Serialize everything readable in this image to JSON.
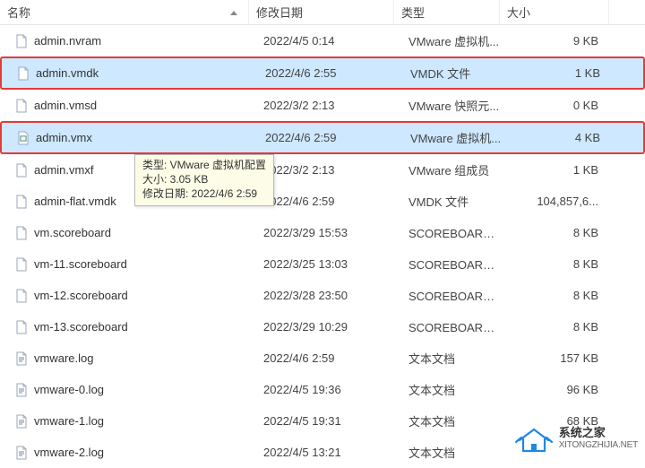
{
  "columns": {
    "name": "名称",
    "date": "修改日期",
    "type": "类型",
    "size": "大小"
  },
  "files": [
    {
      "name": "admin.nvram",
      "date": "2022/4/5 0:14",
      "type": "VMware 虚拟机...",
      "size": "9 KB",
      "icon": "doc",
      "selected": false,
      "highlighted": false
    },
    {
      "name": "admin.vmdk",
      "date": "2022/4/6 2:55",
      "type": "VMDK 文件",
      "size": "1 KB",
      "icon": "doc",
      "selected": true,
      "highlighted": true
    },
    {
      "name": "admin.vmsd",
      "date": "2022/3/2 2:13",
      "type": "VMware 快照元...",
      "size": "0 KB",
      "icon": "doc",
      "selected": false,
      "highlighted": false
    },
    {
      "name": "admin.vmx",
      "date": "2022/4/6 2:59",
      "type": "VMware 虚拟机...",
      "size": "4 KB",
      "icon": "vmx",
      "selected": true,
      "highlighted": true
    },
    {
      "name": "admin.vmxf",
      "date": "2022/3/2 2:13",
      "type": "VMware 组成员",
      "size": "1 KB",
      "icon": "doc",
      "selected": false,
      "highlighted": false
    },
    {
      "name": "admin-flat.vmdk",
      "date": "2022/4/6 2:59",
      "type": "VMDK 文件",
      "size": "104,857,6...",
      "icon": "doc",
      "selected": false,
      "highlighted": false
    },
    {
      "name": "vm.scoreboard",
      "date": "2022/3/29 15:53",
      "type": "SCOREBOARD 文...",
      "size": "8 KB",
      "icon": "doc",
      "selected": false,
      "highlighted": false
    },
    {
      "name": "vm-11.scoreboard",
      "date": "2022/3/25 13:03",
      "type": "SCOREBOARD 文...",
      "size": "8 KB",
      "icon": "doc",
      "selected": false,
      "highlighted": false
    },
    {
      "name": "vm-12.scoreboard",
      "date": "2022/3/28 23:50",
      "type": "SCOREBOARD 文...",
      "size": "8 KB",
      "icon": "doc",
      "selected": false,
      "highlighted": false
    },
    {
      "name": "vm-13.scoreboard",
      "date": "2022/3/29 10:29",
      "type": "SCOREBOARD 文...",
      "size": "8 KB",
      "icon": "doc",
      "selected": false,
      "highlighted": false
    },
    {
      "name": "vmware.log",
      "date": "2022/4/6 2:59",
      "type": "文本文档",
      "size": "157 KB",
      "icon": "txt",
      "selected": false,
      "highlighted": false
    },
    {
      "name": "vmware-0.log",
      "date": "2022/4/5 19:36",
      "type": "文本文档",
      "size": "96 KB",
      "icon": "txt",
      "selected": false,
      "highlighted": false
    },
    {
      "name": "vmware-1.log",
      "date": "2022/4/5 19:31",
      "type": "文本文档",
      "size": "68 KB",
      "icon": "txt",
      "selected": false,
      "highlighted": false
    },
    {
      "name": "vmware-2.log",
      "date": "2022/4/5 13:21",
      "type": "文本文档",
      "size": "",
      "icon": "txt",
      "selected": false,
      "highlighted": false
    }
  ],
  "tooltip": {
    "line1": "类型: VMware 虚拟机配置",
    "line2": "大小: 3.05 KB",
    "line3": "修改日期: 2022/4/6 2:59"
  },
  "watermark": {
    "title": "系统之家",
    "subtitle": "XITONGZHIJIA.NET"
  },
  "colors": {
    "selection": "#cde8ff",
    "highlight_border": "#e53a3a",
    "tooltip_bg": "#fdfde7"
  }
}
